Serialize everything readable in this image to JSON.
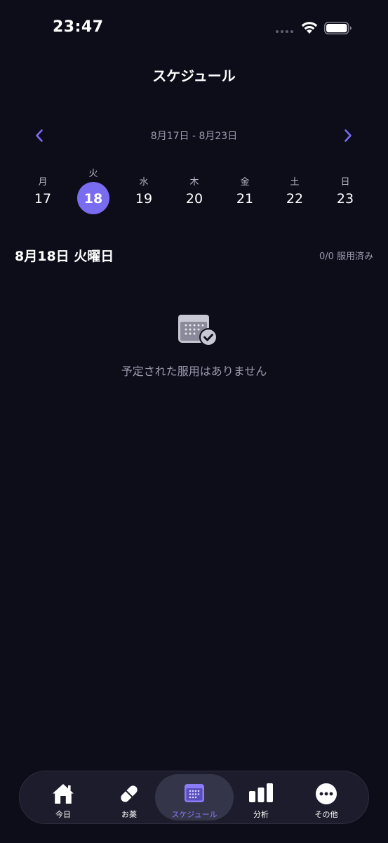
{
  "status_bar": {
    "time": "23:47"
  },
  "header": {
    "title": "スケジュール"
  },
  "week": {
    "range": "8月17日 - 8月23日",
    "days": [
      {
        "weekday": "月",
        "date": "17",
        "selected": false
      },
      {
        "weekday": "火",
        "date": "18",
        "selected": true
      },
      {
        "weekday": "水",
        "date": "19",
        "selected": false
      },
      {
        "weekday": "木",
        "date": "20",
        "selected": false
      },
      {
        "weekday": "金",
        "date": "21",
        "selected": false
      },
      {
        "weekday": "土",
        "date": "22",
        "selected": false
      },
      {
        "weekday": "日",
        "date": "23",
        "selected": false
      }
    ]
  },
  "day_detail": {
    "heading": "8月18日 火曜日",
    "taken_count": "0/0 服用済み",
    "empty_message": "予定された服用はありません"
  },
  "tab_bar": {
    "tabs": [
      {
        "label": "今日",
        "icon": "home-icon",
        "active": false
      },
      {
        "label": "お薬",
        "icon": "pill-icon",
        "active": false
      },
      {
        "label": "スケジュール",
        "icon": "calendar-icon",
        "active": true
      },
      {
        "label": "分析",
        "icon": "bar-chart-icon",
        "active": false
      },
      {
        "label": "その他",
        "icon": "more-icon",
        "active": false
      }
    ]
  },
  "colors": {
    "background": "#0d0d1a",
    "accent": "#7a6cf0",
    "tab_active_label": "#8a7cf5",
    "muted_text": "#9a9aae"
  }
}
